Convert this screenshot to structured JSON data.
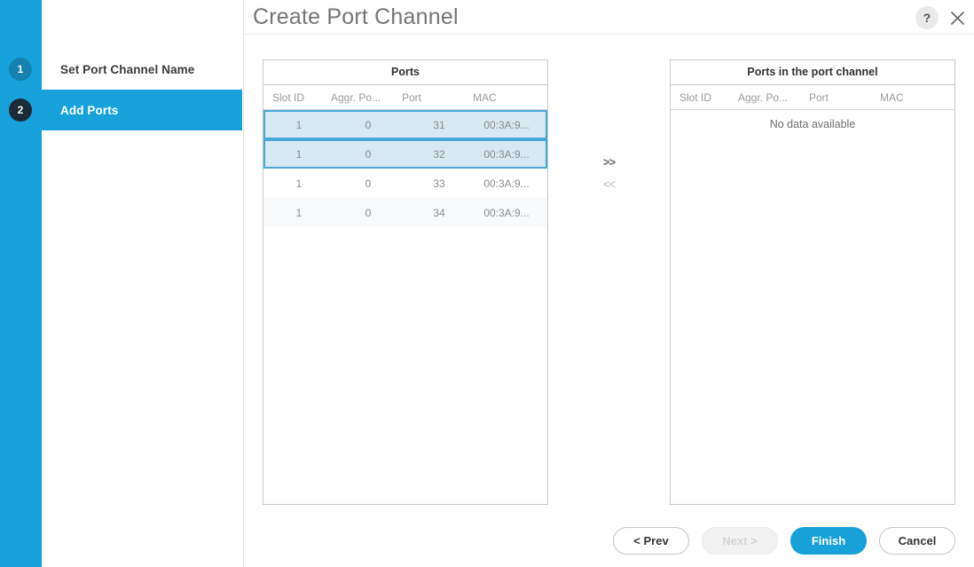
{
  "header": {
    "title": "Create Port Channel",
    "help_label": "?",
    "help_icon": "question-mark-icon",
    "close_icon": "close-icon"
  },
  "sidebar": {
    "steps": [
      {
        "number": "1",
        "label": "Set Port Channel Name",
        "state": "done"
      },
      {
        "number": "2",
        "label": "Add Ports",
        "state": "active"
      }
    ]
  },
  "available_panel": {
    "title": "Ports",
    "columns": [
      "Slot ID",
      "Aggr. Po...",
      "Port",
      "MAC"
    ],
    "rows": [
      {
        "slot_id": "1",
        "aggr_port": "0",
        "port": "31",
        "mac": "00:3A:9...",
        "selected": true
      },
      {
        "slot_id": "1",
        "aggr_port": "0",
        "port": "32",
        "mac": "00:3A:9...",
        "selected": true
      },
      {
        "slot_id": "1",
        "aggr_port": "0",
        "port": "33",
        "mac": "00:3A:9...",
        "selected": false
      },
      {
        "slot_id": "1",
        "aggr_port": "0",
        "port": "34",
        "mac": "00:3A:9...",
        "selected": false
      }
    ]
  },
  "selected_panel": {
    "title": "Ports in the port channel",
    "columns": [
      "Slot ID",
      "Aggr. Po...",
      "Port",
      "MAC"
    ],
    "empty_message": "No data available",
    "rows": []
  },
  "transfer_controls": {
    "add_label": ">>",
    "remove_label": "<<",
    "add_enabled": true,
    "remove_enabled": false
  },
  "footer": {
    "prev_label": "< Prev",
    "next_label": "Next >",
    "finish_label": "Finish",
    "cancel_label": "Cancel"
  },
  "colors": {
    "accent_blue": "#17a2dc",
    "step_done_blue": "#1581ae",
    "step_active_navy": "#1b2b38",
    "selected_row_fill": "#d7e9f2",
    "selected_row_border": "#46a8d7",
    "primary_button": "#18a0d8"
  }
}
